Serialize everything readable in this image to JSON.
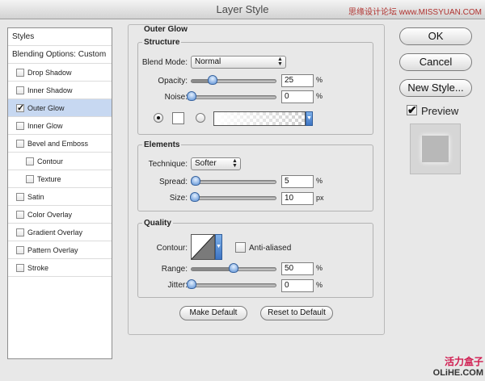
{
  "window": {
    "title": "Layer Style",
    "watermark_top": "思缘设计论坛 www.MISSYUAN.COM"
  },
  "sidebar": {
    "header": "Styles",
    "blending": "Blending Options: Custom",
    "items": [
      {
        "label": "Drop Shadow",
        "checked": false,
        "selected": false,
        "indent": false
      },
      {
        "label": "Inner Shadow",
        "checked": false,
        "selected": false,
        "indent": false
      },
      {
        "label": "Outer Glow",
        "checked": true,
        "selected": true,
        "indent": false
      },
      {
        "label": "Inner Glow",
        "checked": false,
        "selected": false,
        "indent": false
      },
      {
        "label": "Bevel and Emboss",
        "checked": false,
        "selected": false,
        "indent": false
      },
      {
        "label": "Contour",
        "checked": false,
        "selected": false,
        "indent": true
      },
      {
        "label": "Texture",
        "checked": false,
        "selected": false,
        "indent": true
      },
      {
        "label": "Satin",
        "checked": false,
        "selected": false,
        "indent": false
      },
      {
        "label": "Color Overlay",
        "checked": false,
        "selected": false,
        "indent": false
      },
      {
        "label": "Gradient Overlay",
        "checked": false,
        "selected": false,
        "indent": false
      },
      {
        "label": "Pattern Overlay",
        "checked": false,
        "selected": false,
        "indent": false
      },
      {
        "label": "Stroke",
        "checked": false,
        "selected": false,
        "indent": false
      }
    ]
  },
  "outer_glow": {
    "title": "Outer Glow",
    "structure": {
      "title": "Structure",
      "blend_mode_label": "Blend Mode:",
      "blend_mode": "Normal",
      "opacity_label": "Opacity:",
      "opacity": "25",
      "opacity_level": 0.25,
      "noise_label": "Noise:",
      "noise": "0",
      "noise_level": 0,
      "percent": "%"
    },
    "elements": {
      "title": "Elements",
      "technique_label": "Technique:",
      "technique": "Softer",
      "spread_label": "Spread:",
      "spread": "5",
      "spread_level": 0.05,
      "size_label": "Size:",
      "size": "10",
      "size_level": 0.04,
      "percent": "%",
      "px": "px"
    },
    "quality": {
      "title": "Quality",
      "contour_label": "Contour:",
      "anti_aliased": "Anti-aliased",
      "range_label": "Range:",
      "range": "50",
      "range_level": 0.5,
      "jitter_label": "Jitter:",
      "jitter": "0",
      "jitter_level": 0,
      "percent": "%"
    },
    "make_default": "Make Default",
    "reset_default": "Reset to Default"
  },
  "buttons": {
    "ok": "OK",
    "cancel": "Cancel",
    "new_style": "New Style...",
    "preview": "Preview"
  },
  "watermark_bottom": {
    "line1": "活力盒子",
    "line2": "OLiHE.COM"
  }
}
